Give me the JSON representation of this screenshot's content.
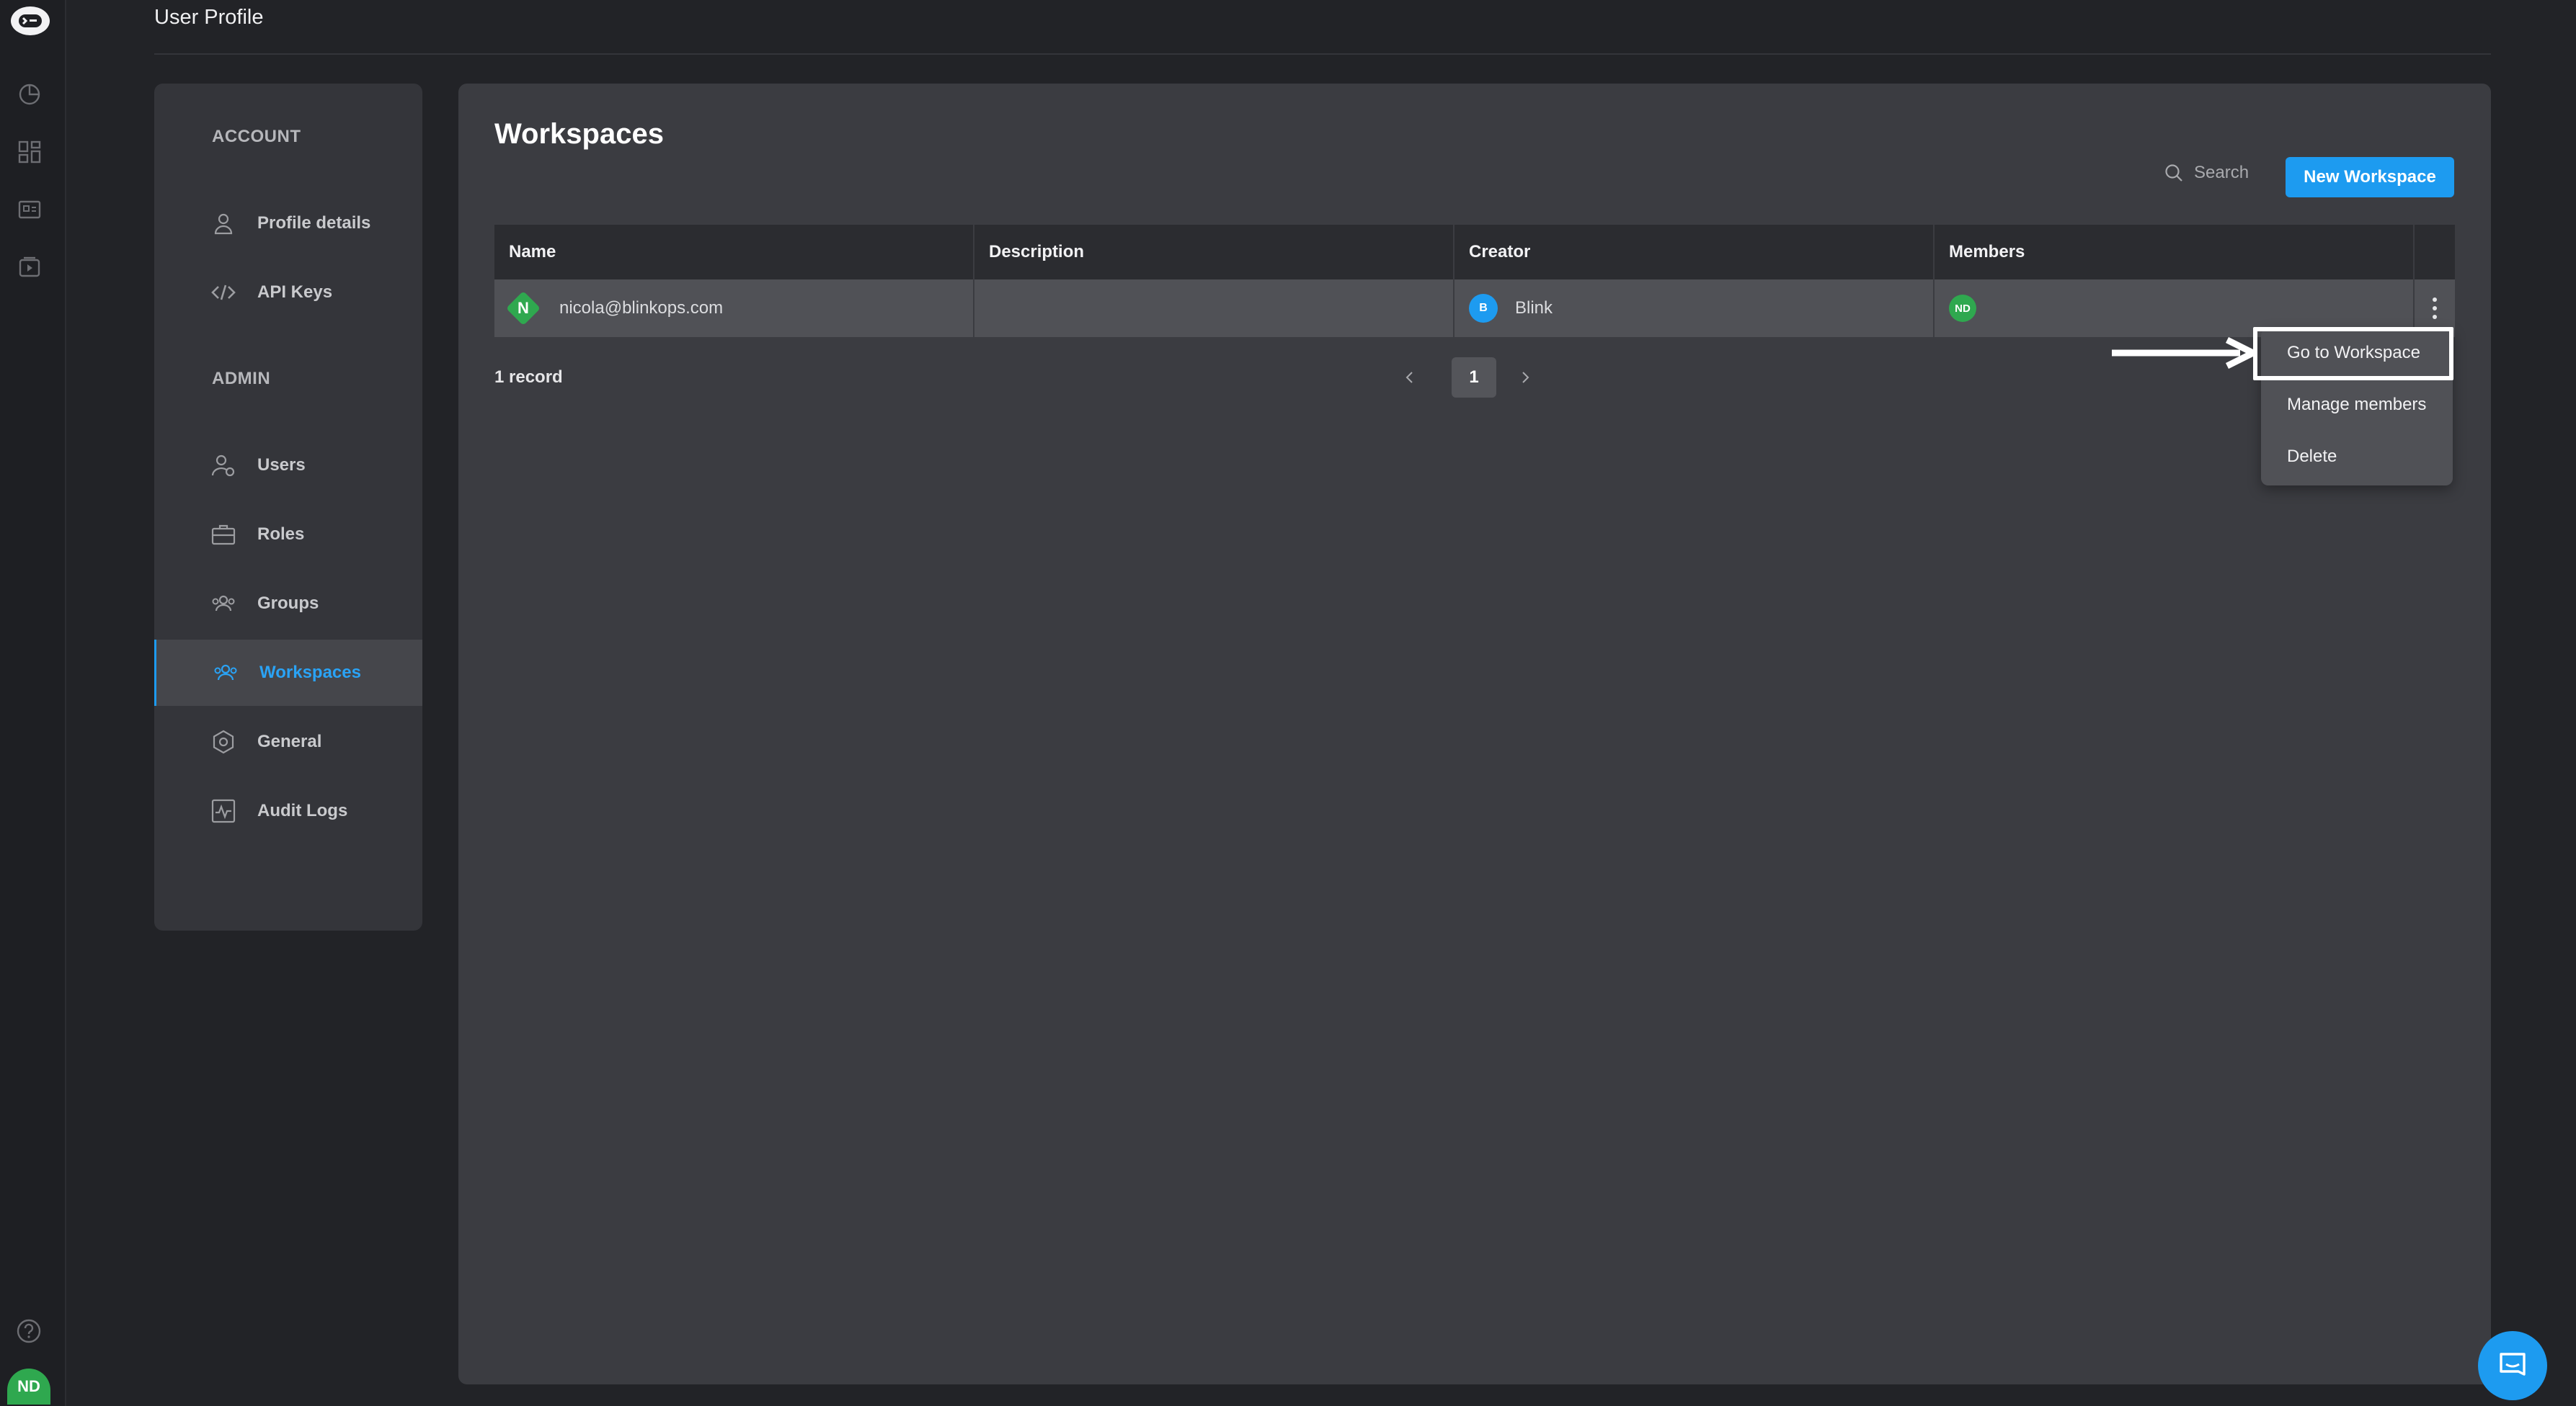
{
  "header": {
    "title": "User Profile"
  },
  "sidebar": {
    "sections": [
      {
        "label": "ACCOUNT",
        "items": [
          {
            "label": "Profile details"
          },
          {
            "label": "API Keys"
          }
        ]
      },
      {
        "label": "ADMIN",
        "items": [
          {
            "label": "Users"
          },
          {
            "label": "Roles"
          },
          {
            "label": "Groups"
          },
          {
            "label": "Workspaces",
            "active": true
          },
          {
            "label": "General"
          },
          {
            "label": "Audit Logs"
          }
        ]
      }
    ]
  },
  "main": {
    "title": "Workspaces",
    "search_label": "Search",
    "new_button_label": "New Workspace",
    "table": {
      "columns": [
        "Name",
        "Description",
        "Creator",
        "Members"
      ],
      "rows": [
        {
          "name_initial": "N",
          "name": "nicola@blinkops.com",
          "description": "",
          "creator_initial": "B",
          "creator": "Blink",
          "members_initials": "ND"
        }
      ]
    },
    "record_count": "1 record",
    "pagination": {
      "current_page": "1"
    }
  },
  "row_menu": {
    "items": [
      {
        "label": "Go to Workspace",
        "highlighted": true
      },
      {
        "label": "Manage members"
      },
      {
        "label": "Delete"
      }
    ]
  },
  "user": {
    "initials": "ND"
  },
  "colors": {
    "accent": "#1d9bf0",
    "avatar_green": "#2fa84f",
    "background": "#222327",
    "card": "#3b3c41"
  },
  "icons": [
    "app-logo-icon",
    "dashboard-icon",
    "grid-icon",
    "gallery-icon",
    "play-icon",
    "help-icon",
    "user-icon",
    "code-icon",
    "users-icon",
    "briefcase-icon",
    "group-icon",
    "workspaces-icon",
    "gear-icon",
    "activity-icon",
    "search-icon",
    "chevron-left-icon",
    "chevron-right-icon",
    "kebab-icon",
    "chat-icon",
    "arrow-right-icon"
  ]
}
